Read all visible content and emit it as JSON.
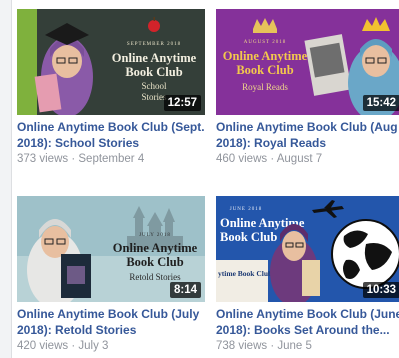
{
  "colors": {
    "link": "#365899",
    "meta_text": "#90949c",
    "duration_bg": "#000000"
  },
  "videos": [
    {
      "thumb_month": "SEPTEMBER 2018",
      "thumb_line1": "Online Anytime",
      "thumb_line2": "Book Club",
      "thumb_subtitle_1": "School",
      "thumb_subtitle_2": "Stories",
      "duration": "12:57",
      "title": "Online Anytime Book Club (Sept. 2018): School Stories",
      "views": "373 views",
      "separator": " · ",
      "date": "September 4",
      "icon": "apple-icon"
    },
    {
      "thumb_month": "AUGUST 2018",
      "thumb_line1": "Online Anytime",
      "thumb_line2": "Book Club",
      "thumb_subtitle_1": "Royal Reads",
      "duration": "15:42",
      "title": "Online Anytime Book Club (Aug 2018): Royal Reads",
      "views": "460 views",
      "separator": " · ",
      "date": "August 7",
      "icon": "crown-icon"
    },
    {
      "thumb_month": "JULY 2018",
      "thumb_line1": "Online Anytime",
      "thumb_line2": "Book Club",
      "thumb_subtitle_1": "Retold Stories",
      "duration": "8:14",
      "title": "Online Anytime Book Club (July 2018): Retold Stories",
      "views": "420 views",
      "separator": " · ",
      "date": "July 3",
      "icon": "castle-icon"
    },
    {
      "thumb_month": "JUNE 2018",
      "thumb_line1": "Online Anytime",
      "thumb_line2": "Book Club",
      "thumb_book_label": "ytime Book Club",
      "duration": "10:33",
      "title": "Online Anytime Book Club (June 2018): Books Set Around the...",
      "views": "738 views",
      "separator": " · ",
      "date": "June 5",
      "icon": "globe-icon"
    }
  ]
}
